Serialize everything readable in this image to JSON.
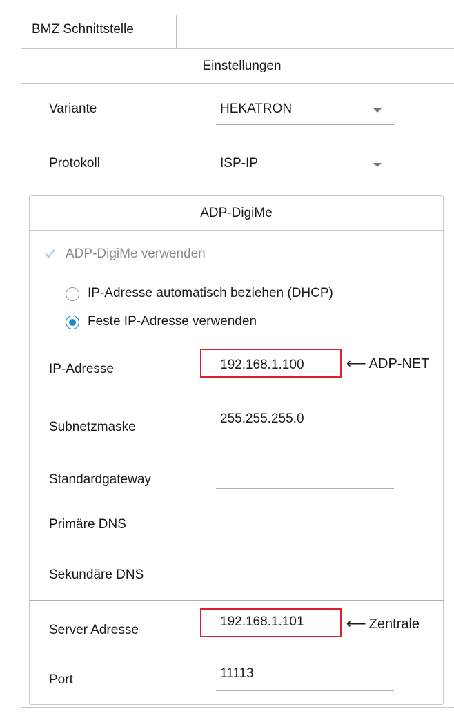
{
  "tab": {
    "label": "BMZ Schnittstelle"
  },
  "settings": {
    "header": "Einstellungen",
    "variante": {
      "label": "Variante",
      "value": "HEKATRON"
    },
    "protokoll": {
      "label": "Protokoll",
      "value": "ISP-IP"
    }
  },
  "adp": {
    "header": "ADP-DigiMe",
    "use_checkbox": {
      "label": "ADP-DigiMe verwenden",
      "checked": true,
      "disabled": true
    },
    "radio_dhcp": {
      "label": "IP-Adresse automatisch beziehen (DHCP)",
      "checked": false
    },
    "radio_static": {
      "label": "Feste IP-Adresse verwenden",
      "checked": true
    },
    "ip": {
      "label": "IP-Adresse",
      "value": "192.168.1.100"
    },
    "subnet": {
      "label": "Subnetzmaske",
      "value": "255.255.255.0"
    },
    "gateway": {
      "label": "Standardgateway",
      "value": ""
    },
    "dns1": {
      "label": "Primäre DNS",
      "value": ""
    },
    "dns2": {
      "label": "Sekundäre DNS",
      "value": ""
    },
    "server": {
      "label": "Server Adresse",
      "value": "192.168.1.101"
    },
    "port": {
      "label": "Port",
      "value": "11113"
    }
  },
  "annotations": {
    "ip_note": "ADP-NET",
    "server_note": "Zentrale",
    "highlight_color": "#e0202c"
  },
  "colors": {
    "accent": "#1e88d4"
  }
}
